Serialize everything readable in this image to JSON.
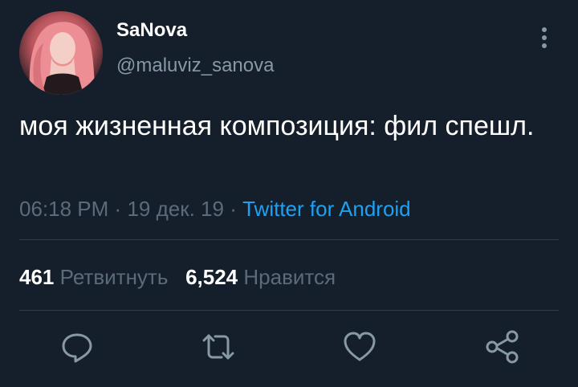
{
  "tweet": {
    "display_name": "SaNova",
    "handle": "@maluviz_sanova",
    "text": "моя жизненная композиция: фил спешл.",
    "time": "06:18 PM",
    "date": "19 дек. 19",
    "separator": "·",
    "source": "Twitter for Android",
    "retweets_count": "461",
    "retweets_label": "Ретвитнуть",
    "likes_count": "6,524",
    "likes_label": "Нравится"
  },
  "icons": {
    "more": "more-vertical-icon",
    "reply": "reply-icon",
    "retweet": "retweet-icon",
    "like": "heart-icon",
    "share": "share-icon"
  },
  "colors": {
    "background": "#151f2b",
    "primary_text": "#ffffff",
    "secondary_text": "#8899a6",
    "muted_text": "#5b6b7a",
    "link": "#1da1f2",
    "divider": "#2f3b47"
  }
}
